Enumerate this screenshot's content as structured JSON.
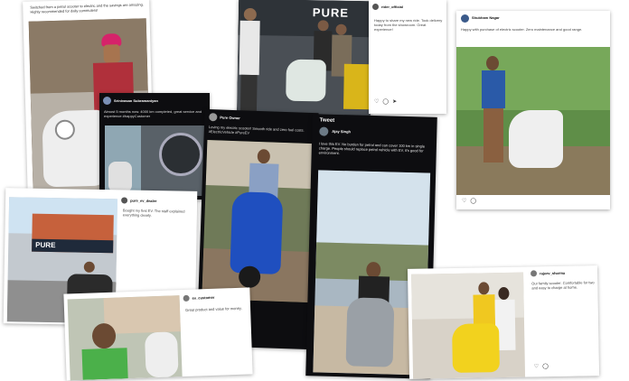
{
  "brand": {
    "logo_text": "PURE",
    "accent": "#1e8fd6"
  },
  "post_tl": {
    "caption": "Switched from a petrol scooter to electric and the savings are amazing. Highly recommended for daily commuters!",
    "caption2": "Five years of riding, never looked back. Thank you for the great service."
  },
  "post_dark1": {
    "handle": "Srinivasan Subramaniyan",
    "text": "Almost 5 months now. 4000 km completed, great service and experience #happyCustomer"
  },
  "post_dark2": {
    "handle": "Pure Owner",
    "text": "Loving my electric scooter! Smooth ride and zero fuel costs. #ElectricVehicle #PureEV"
  },
  "post_tweet": {
    "title": "Tweet",
    "handle": "Ajay Singh",
    "text": "I love this EV. No burden for petrol and can cover 100 km in single charge. People should replace petrol vehicle with EV, it's good for environment."
  },
  "post_top_mid": {
    "handle": "rider_official",
    "text": "Happy to share my new ride. Took delivery today from the showroom. Great experience!"
  },
  "post_top_right": {
    "handle": "Shubham Nagar",
    "text": "Happy with purchase of electric scooter. Zero maintenance and good range."
  },
  "post_mid_left": {
    "handle": "pure_ev_dealer",
    "text": "Bought my first EV. The staff explained everything clearly.",
    "sign_text": "PURE"
  },
  "post_bottom_left": {
    "handle": "ev_customer",
    "text": "Great product and value for money."
  },
  "post_bottom_right": {
    "handle": "rajeev_sharma",
    "text": "Our family scooter. Comfortable for two and easy to charge at home."
  },
  "colors": {
    "scooter_white": "#eeeeee",
    "scooter_blue": "#1f4fbf",
    "scooter_yellow": "#f2d21e",
    "scooter_grey": "#9aa0a6",
    "grass": "#4e8a3a",
    "sky": "#cfe3f2"
  }
}
